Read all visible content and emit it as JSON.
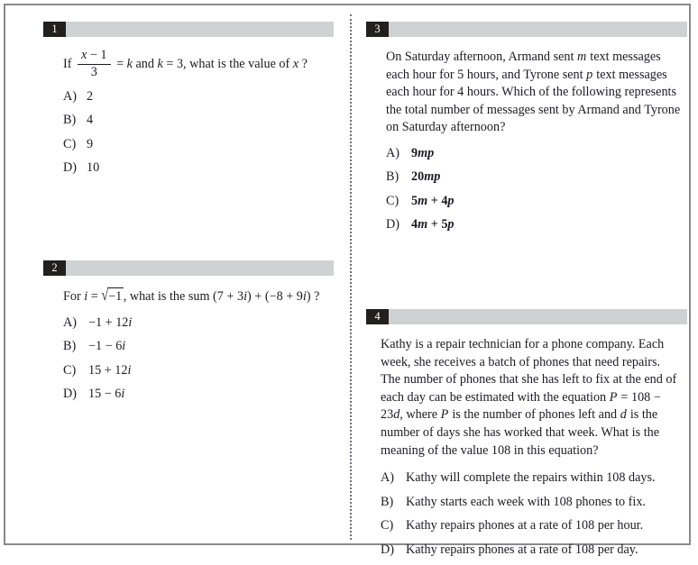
{
  "document": {
    "title": "Math Practice Questions",
    "columns": 2,
    "accent_badge_color": "#221f1f",
    "header_bar_color": "#d0d1d3",
    "page_border_color": "#8a8a8a",
    "text_color": "#1b1b24"
  },
  "questions": [
    {
      "number": "1",
      "column": "left",
      "stem_plain": "If (x − 1)/3 = k and k = 3, what is the value of x ?",
      "stem_parts": {
        "lead": "If",
        "frac_numerator_var": "x",
        "frac_numerator_rest": "− 1",
        "frac_denominator": "3",
        "eq": "=",
        "k1": "k",
        "and": "and",
        "k2": "k",
        "eq2": "= 3,",
        "tail": "what is the value of",
        "var": "x",
        "qmark": "?"
      },
      "choices": [
        {
          "letter": "A)",
          "text": "2"
        },
        {
          "letter": "B)",
          "text": "4"
        },
        {
          "letter": "C)",
          "text": "9"
        },
        {
          "letter": "D)",
          "text": "10"
        }
      ]
    },
    {
      "number": "2",
      "column": "left",
      "stem_plain": "For i = √−1 , what is the sum (7 + 3i) + (−8 + 9i) ?",
      "stem_parts": {
        "lead": "For",
        "var_i": "i",
        "eq": "=",
        "radicand": "−1",
        "comma": ",",
        "mid": "what is the sum",
        "expr1": "(7 + 3",
        "i1": "i",
        "expr2": ")",
        "plus": "+",
        "expr3": "(−8 + 9",
        "i2": "i",
        "expr4": ")",
        "qmark": "?"
      },
      "choices": [
        {
          "letter": "A)",
          "prefix": "−1 + 12",
          "italic": "i",
          "suffix": ""
        },
        {
          "letter": "B)",
          "prefix": "−1 − 6",
          "italic": "i",
          "suffix": ""
        },
        {
          "letter": "C)",
          "prefix": "15 + 12",
          "italic": "i",
          "suffix": ""
        },
        {
          "letter": "D)",
          "prefix": "15 − 6",
          "italic": "i",
          "suffix": ""
        }
      ]
    },
    {
      "number": "3",
      "column": "right",
      "stem_plain": "On Saturday afternoon, Armand sent m text messages each hour for 5 hours, and Tyrone sent p text messages each hour for 4 hours.  Which of the following represents the total number of messages sent by Armand and Tyrone on Saturday afternoon?",
      "stem_parts": {
        "p1": "On Saturday afternoon, Armand sent",
        "m": "m",
        "p2": "text messages each hour for 5 hours, and Tyrone sent",
        "p": "p",
        "p3": "text messages each hour for 4 hours.  Which of the following represents the total number of messages sent by Armand and Tyrone on Saturday afternoon?"
      },
      "choices": [
        {
          "letter": "A)",
          "prefix": "9",
          "italic": "mp",
          "suffix": ""
        },
        {
          "letter": "B)",
          "prefix": "20",
          "italic": "mp",
          "suffix": ""
        },
        {
          "letter": "C)",
          "prefix": "5",
          "italic": "m",
          "mid": " + 4",
          "italic2": "p",
          "suffix": ""
        },
        {
          "letter": "D)",
          "prefix": "4",
          "italic": "m",
          "mid": " + 5",
          "italic2": "p",
          "suffix": ""
        }
      ]
    },
    {
      "number": "4",
      "column": "right",
      "stem_plain": "Kathy is a repair technician for a phone company. Each week, she receives a batch of phones that need repairs.  The number of phones that she has left to fix at the end of each day can be estimated with the equation P = 108 − 23d, where P is the number of phones left and d is the number of days she has worked that week.  What is the meaning of the value 108 in this equation?",
      "stem_parts": {
        "p1": "Kathy is a repair technician for a phone company. Each week, she receives a batch of phones that need repairs.  The number of phones that she has left to fix at the end of each day can be estimated with the equation",
        "P1": "P",
        "eq": "= 108 − 23",
        "d1": "d",
        "p2": ", where",
        "P2": "P",
        "p3": "is the number of phones left and",
        "d2": "d",
        "p4": "is the number of days she has worked that week.  What is the meaning of the value 108 in this equation?"
      },
      "choices": [
        {
          "letter": "A)",
          "text": "Kathy will complete the repairs within 108 days."
        },
        {
          "letter": "B)",
          "text": "Kathy starts each week with 108 phones to fix."
        },
        {
          "letter": "C)",
          "text": "Kathy repairs phones at a rate of 108 per hour."
        },
        {
          "letter": "D)",
          "text": "Kathy repairs phones at a rate of 108 per day."
        }
      ]
    }
  ]
}
